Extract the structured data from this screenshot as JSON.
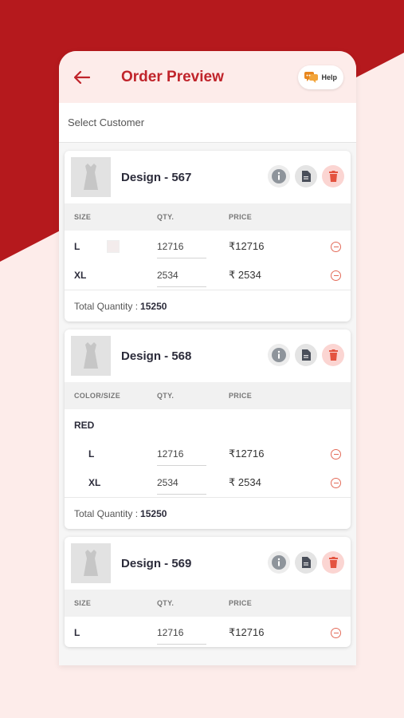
{
  "colors": {
    "brand_red": "#b5191d",
    "title_red": "#c0242b",
    "bg_pink": "#fdecea"
  },
  "header": {
    "title": "Order Preview",
    "help_label": "Help",
    "back_icon": "arrow-left-icon",
    "help_icon": "chat-bubbles-icon"
  },
  "customer": {
    "placeholder": "Select Customer"
  },
  "cards": [
    {
      "title": "Design - 567",
      "headers": {
        "size": "SIZE",
        "qty": "QTY.",
        "price": "PRICE"
      },
      "rows": [
        {
          "size": "L",
          "qty": "12716",
          "price": "₹12716"
        },
        {
          "size": "XL",
          "qty": "2534",
          "price": "₹ 2534"
        }
      ],
      "total_label": "Total Quantity :",
      "total_value": "15250"
    },
    {
      "title": "Design - 568",
      "headers": {
        "size": "COLOR/SIZE",
        "qty": "QTY.",
        "price": "PRICE"
      },
      "color": "RED",
      "rows": [
        {
          "size": "L",
          "qty": "12716",
          "price": "₹12716"
        },
        {
          "size": "XL",
          "qty": "2534",
          "price": "₹ 2534"
        }
      ],
      "total_label": "Total Quantity :",
      "total_value": "15250"
    },
    {
      "title": "Design - 569",
      "headers": {
        "size": "SIZE",
        "qty": "QTY.",
        "price": "PRICE"
      },
      "rows": [
        {
          "size": "L",
          "qty": "12716",
          "price": "₹12716"
        }
      ]
    }
  ]
}
